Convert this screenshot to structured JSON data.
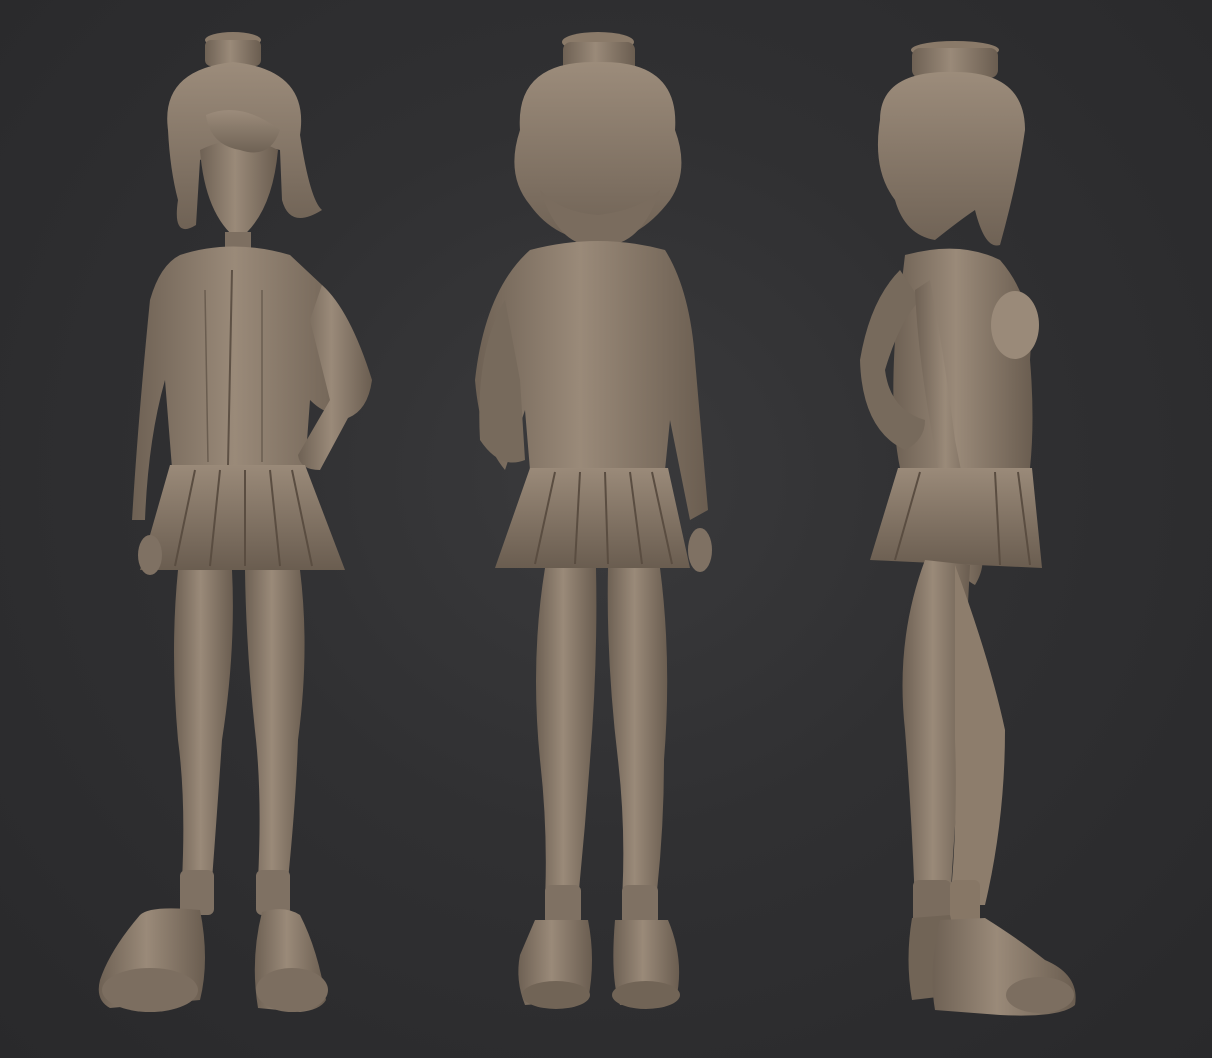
{
  "scene": {
    "background_color": "#2f2f31",
    "clay_color": "#8b7b6a",
    "clay_shadow_color": "#5a4d41",
    "clay_highlight_color": "#a8988a",
    "views": [
      {
        "name": "front-view",
        "description_icon": "figure-front-icon"
      },
      {
        "name": "back-view",
        "description_icon": "figure-back-icon"
      },
      {
        "name": "side-view",
        "description_icon": "figure-side-icon"
      }
    ]
  }
}
